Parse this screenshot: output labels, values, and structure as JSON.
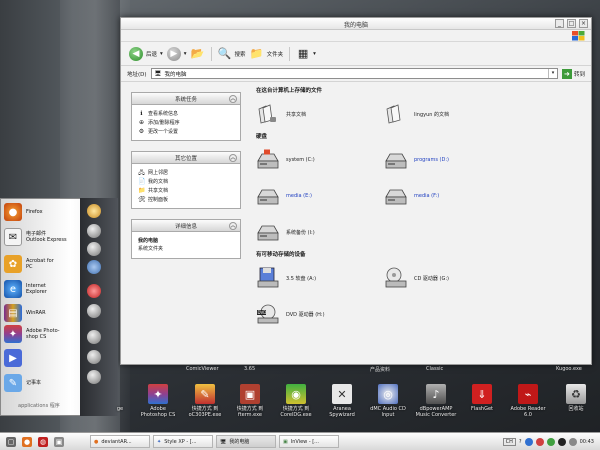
{
  "window": {
    "title": "我的电脑",
    "toolbar": {
      "back": "后退",
      "search": "搜索",
      "folders": "文件夹"
    },
    "address": {
      "label": "地址(D)",
      "value": "我的电脑",
      "go": "转到"
    }
  },
  "sidebar": {
    "system_tasks": {
      "title": "系统任务",
      "items": [
        "查看系统信息",
        "添加/删除程序",
        "更改一个设置"
      ]
    },
    "other_places": {
      "title": "其它位置",
      "items": [
        "网上邻居",
        "我的文档",
        "共享文档",
        "控制面板"
      ]
    },
    "details": {
      "title": "详细信息",
      "name": "我的电脑",
      "type": "系统文件夹"
    }
  },
  "content": {
    "section_files": "在这台计算机上存储的文件",
    "files": [
      "共享文档",
      "lingyun 的文档"
    ],
    "section_drives": "硬盘",
    "drives": [
      "system (C:)",
      "programs (D:)",
      "media (E:)",
      "media (F:)",
      "系统备份 (I:)"
    ],
    "section_removable": "有可移动存储的设备",
    "removable": [
      "3.5 软盘 (A:)",
      "CD 驱动器 (G:)",
      "DVD 驱动器 (H:)"
    ]
  },
  "dock": {
    "items": [
      "Firefox",
      "电子邮件\nOutlook Express",
      "Acrobat for\nPC",
      "Internet\nExplorer",
      "WinRAR",
      "Adobe Photo-\nshop CS",
      "记事本"
    ],
    "footer": "applications 程序"
  },
  "desktop_labels": [
    "ComicViewer",
    "3.65",
    "产品资料",
    "Classic",
    "Kugoo.exe"
  ],
  "desktop_icons": [
    "ge",
    "Adobe\nPhotoshop CS",
    "快捷方式 到\noC303PE.exe",
    "快捷方式 到\nfterm.exe",
    "快捷方式 到\nCorelDG.exe",
    "Aranea\nSpywizard",
    "dMC Audio CD\nInput",
    "dBpowerAMP\nMusic Converter",
    "FlashGet",
    "Adobe Reader\n6.0",
    "回收站"
  ],
  "taskbar": {
    "tasks": [
      "deviantAR...",
      "Style XP - [...",
      "我的电脑",
      "InView - [..."
    ],
    "lang": "CH",
    "clock": "00:43"
  },
  "colors": {
    "accent_link": "#2040c0",
    "go_green": "#3d9b3a"
  }
}
